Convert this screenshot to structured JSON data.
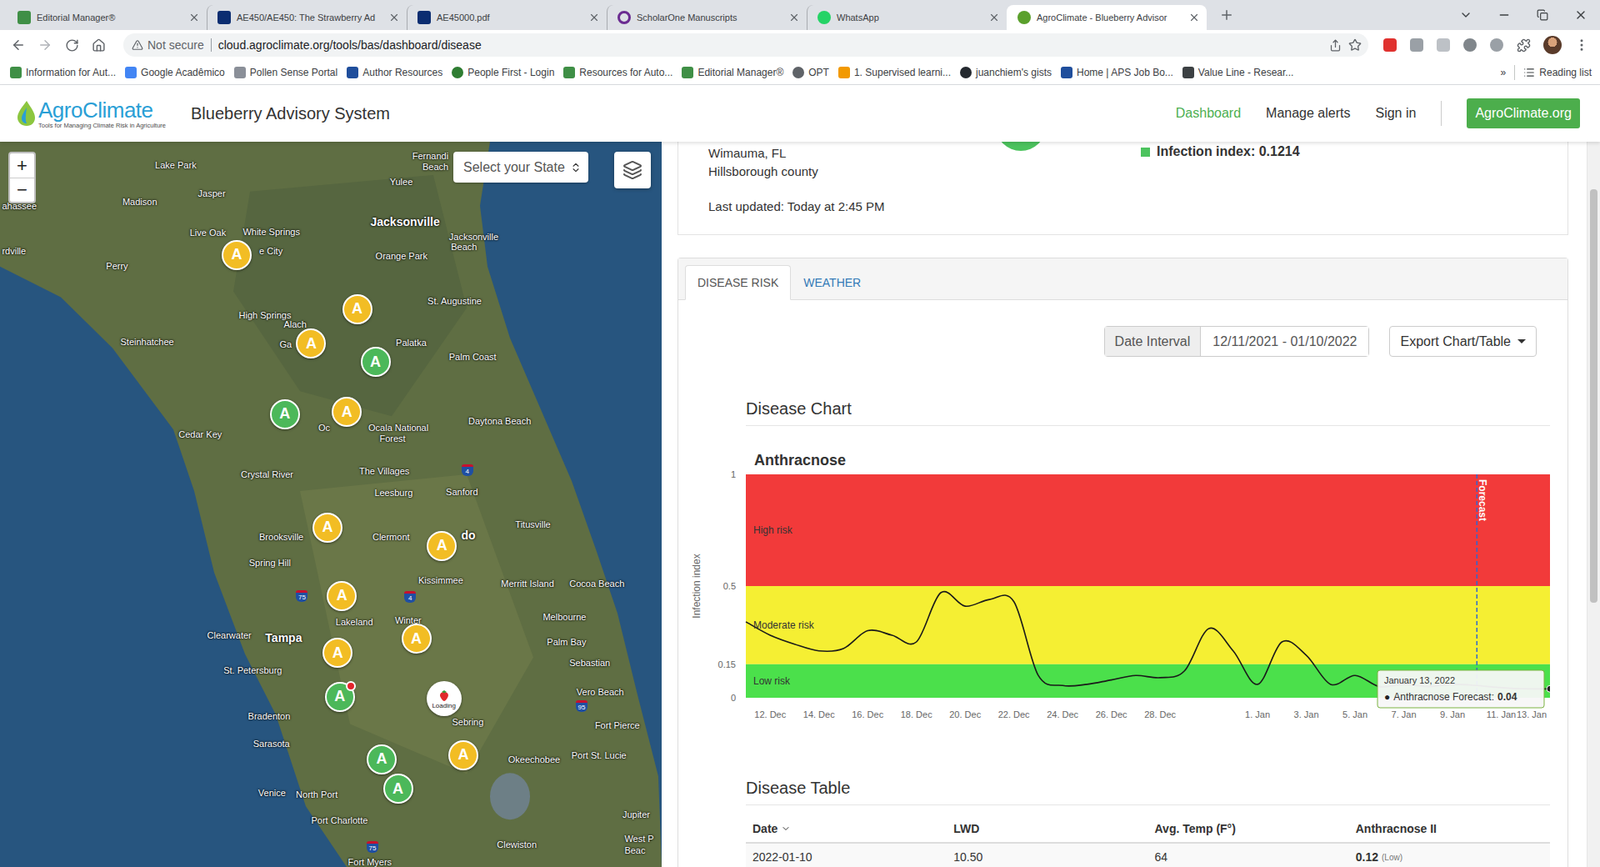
{
  "browser": {
    "tabs": [
      {
        "title": "Editorial Manager®",
        "selected": false,
        "kind": "em"
      },
      {
        "title": "AE450/AE450: The Strawberry Ad",
        "selected": false,
        "kind": "ifas"
      },
      {
        "title": "AE45000.pdf",
        "selected": false,
        "kind": "ifas"
      },
      {
        "title": "ScholarOne Manuscripts",
        "selected": false,
        "kind": "scholarone"
      },
      {
        "title": "WhatsApp",
        "selected": false,
        "kind": "whatsapp"
      },
      {
        "title": "AgroClimate - Blueberry Advisor",
        "selected": true,
        "kind": "agro"
      }
    ],
    "security": "Not secure",
    "url": "cloud.agroclimate.org/tools/bas/dashboard/disease",
    "bookmarks": [
      {
        "label": "Information for Aut...",
        "kind": "em"
      },
      {
        "label": "Google Acadêmico",
        "kind": "scholar"
      },
      {
        "label": "Pollen Sense Portal",
        "kind": "page"
      },
      {
        "label": "Author Resources",
        "kind": "aps"
      },
      {
        "label": "People First - Login",
        "kind": "people"
      },
      {
        "label": "Resources for Auto...",
        "kind": "em"
      },
      {
        "label": "Editorial Manager®",
        "kind": "em"
      },
      {
        "label": "OPT",
        "kind": "opt"
      },
      {
        "label": "1. Supervised learni...",
        "kind": "chart"
      },
      {
        "label": "juanchiem's gists",
        "kind": "github"
      },
      {
        "label": "Home | APS Job Bo...",
        "kind": "aps"
      },
      {
        "label": "Value Line - Resear...",
        "kind": "valueline"
      }
    ],
    "more": "»",
    "reading_list": "Reading list"
  },
  "header": {
    "logo": {
      "name": "AgroClimate",
      "tagline": "Tools for Managing Climate Risk in Agriculture"
    },
    "title": "Blueberry Advisory System",
    "nav": [
      {
        "label": "Dashboard",
        "selected": true
      },
      {
        "label": "Manage alerts",
        "selected": false
      },
      {
        "label": "Sign in",
        "selected": false
      }
    ],
    "site_button": "AgroClimate.org"
  },
  "map": {
    "zoom_in": "+",
    "zoom_out": "−",
    "state_select": {
      "placeholder": "Select your State"
    },
    "labels": [
      {
        "text": "ahassee",
        "kind": "city"
      },
      {
        "text": "Lake Park",
        "kind": "city"
      },
      {
        "text": "Fernandi",
        "kind": "city"
      },
      {
        "text": "Beach",
        "kind": "city"
      },
      {
        "text": "Jasper",
        "kind": "city"
      },
      {
        "text": "Yulee",
        "kind": "city"
      },
      {
        "text": "Madison",
        "kind": "city"
      },
      {
        "text": "Jacksonville",
        "kind": "major"
      },
      {
        "text": "Jacksonville",
        "kind": "city"
      },
      {
        "text": "Beach",
        "kind": "city"
      },
      {
        "text": "Live Oak",
        "kind": "city"
      },
      {
        "text": "White Springs",
        "kind": "city"
      },
      {
        "text": "e City",
        "kind": "city"
      },
      {
        "text": "Orange Park",
        "kind": "city"
      },
      {
        "text": "rdville",
        "kind": "city"
      },
      {
        "text": "Perry",
        "kind": "city"
      },
      {
        "text": "High Springs",
        "kind": "city"
      },
      {
        "text": "Alach",
        "kind": "city"
      },
      {
        "text": "St. Augustine",
        "kind": "city"
      },
      {
        "text": "Palatka",
        "kind": "city"
      },
      {
        "text": "Palm Coast",
        "kind": "city"
      },
      {
        "text": "Steinhatchee",
        "kind": "city"
      },
      {
        "text": "Ga",
        "kind": "city"
      },
      {
        "text": "Oc",
        "kind": "city"
      },
      {
        "text": "Ocala National",
        "kind": "city"
      },
      {
        "text": "Forest",
        "kind": "city"
      },
      {
        "text": "Cedar Key",
        "kind": "city"
      },
      {
        "text": "Daytona Beach",
        "kind": "city"
      },
      {
        "text": "Crystal River",
        "kind": "city"
      },
      {
        "text": "The Villages",
        "kind": "city"
      },
      {
        "text": "Leesburg",
        "kind": "city"
      },
      {
        "text": "Sanford",
        "kind": "city"
      },
      {
        "text": "Brooksville",
        "kind": "city"
      },
      {
        "text": "Clermont",
        "kind": "city"
      },
      {
        "text": "do",
        "kind": "major"
      },
      {
        "text": "Titusville",
        "kind": "city"
      },
      {
        "text": "Spring Hill",
        "kind": "city"
      },
      {
        "text": "Kissimmee",
        "kind": "city"
      },
      {
        "text": "Merritt Island",
        "kind": "city"
      },
      {
        "text": "Cocoa Beach",
        "kind": "city"
      },
      {
        "text": "Lakeland",
        "kind": "city"
      },
      {
        "text": "Winter",
        "kind": "city"
      },
      {
        "text": "Melbourne",
        "kind": "city"
      },
      {
        "text": "Clearwater",
        "kind": "city"
      },
      {
        "text": "Tampa",
        "kind": "major"
      },
      {
        "text": "Palm Bay",
        "kind": "city"
      },
      {
        "text": "St. Petersburg",
        "kind": "city"
      },
      {
        "text": "Sebastian",
        "kind": "city"
      },
      {
        "text": "Sebring",
        "kind": "city"
      },
      {
        "text": "Bradenton",
        "kind": "city"
      },
      {
        "text": "Vero Beach",
        "kind": "city"
      },
      {
        "text": "Fort Pierce",
        "kind": "city"
      },
      {
        "text": "Sarasota",
        "kind": "city"
      },
      {
        "text": "Port St. Lucie",
        "kind": "city"
      },
      {
        "text": "Venice",
        "kind": "city"
      },
      {
        "text": "North Port",
        "kind": "city"
      },
      {
        "text": "Okeechobee",
        "kind": "city"
      },
      {
        "text": "Port Charlotte",
        "kind": "city"
      },
      {
        "text": "Jupiter",
        "kind": "city"
      },
      {
        "text": "Clewiston",
        "kind": "city"
      },
      {
        "text": "West P",
        "kind": "city"
      },
      {
        "text": "Beac",
        "kind": "city"
      },
      {
        "text": "Fort Myers",
        "kind": "city"
      }
    ],
    "shields": [
      "75",
      "4",
      "4",
      "95",
      "75"
    ],
    "stations": [
      {
        "label": "A",
        "color": "#f2bd24",
        "selected": false
      },
      {
        "label": "A",
        "color": "#f2bd24",
        "selected": false
      },
      {
        "label": "A",
        "color": "#f2bd24",
        "selected": false
      },
      {
        "label": "A",
        "color": "#4cb85a",
        "selected": false
      },
      {
        "label": "A",
        "color": "#4cb85a",
        "selected": false
      },
      {
        "label": "A",
        "color": "#f2bd24",
        "selected": false
      },
      {
        "label": "A",
        "color": "#f2bd24",
        "selected": false
      },
      {
        "label": "A",
        "color": "#f2bd24",
        "selected": false
      },
      {
        "label": "A",
        "color": "#f2bd24",
        "selected": false
      },
      {
        "label": "A",
        "color": "#f2bd24",
        "selected": false
      },
      {
        "label": "A",
        "color": "#f2bd24",
        "selected": false
      },
      {
        "label": "A",
        "color": "#4cb85a",
        "selected": true
      },
      {
        "label": "A",
        "color": "#4cb85a",
        "selected": false
      },
      {
        "label": "A",
        "color": "#f2bd24",
        "selected": false
      },
      {
        "label": "A",
        "color": "#4cb85a",
        "selected": false
      }
    ],
    "loading_station": {
      "label": "Loading"
    }
  },
  "station_card": {
    "location": "Wimauma, FL",
    "county": "Hillsborough county",
    "last_updated": "Last updated: Today at 2:45 PM",
    "risk_color": "#4cc35e",
    "infection_index": "Infection index: 0.1214"
  },
  "panel": {
    "tabs": [
      {
        "label": "DISEASE RISK",
        "selected": true
      },
      {
        "label": "WEATHER",
        "selected": false
      }
    ],
    "date_interval": {
      "label": "Date Interval",
      "value": "12/11/2021 - 01/10/2022"
    },
    "export": {
      "label": "Export Chart/Table"
    }
  },
  "chart": {
    "heading": "Disease Chart",
    "title": "Anthracnose",
    "y_axis": {
      "title": "Infection index",
      "ticks": [
        "1",
        "0.5",
        "0.15",
        "0"
      ]
    },
    "bands": [
      {
        "label": "High risk",
        "from": 0.5,
        "to": 1,
        "color": "#f23a3a"
      },
      {
        "label": "Moderate risk",
        "from": 0.15,
        "to": 0.5,
        "color": "#f5ef33"
      },
      {
        "label": "Low risk",
        "from": 0,
        "to": 0.15,
        "color": "#4be04b"
      }
    ],
    "x_axis": {
      "ticks": [
        {
          "label": "12. Dec",
          "day": 1
        },
        {
          "label": "14. Dec",
          "day": 3
        },
        {
          "label": "16. Dec",
          "day": 5
        },
        {
          "label": "18. Dec",
          "day": 7
        },
        {
          "label": "20. Dec",
          "day": 9
        },
        {
          "label": "22. Dec",
          "day": 11
        },
        {
          "label": "24. Dec",
          "day": 13
        },
        {
          "label": "26. Dec",
          "day": 15
        },
        {
          "label": "28. Dec",
          "day": 17
        },
        {
          "label": "1. Jan",
          "day": 21
        },
        {
          "label": "3. Jan",
          "day": 23
        },
        {
          "label": "5. Jan",
          "day": 25
        },
        {
          "label": "7. Jan",
          "day": 27
        },
        {
          "label": "9. Jan",
          "day": 29
        },
        {
          "label": "11. Jan",
          "day": 31
        },
        {
          "label": "13. Jan",
          "day": 33
        }
      ]
    },
    "series": [
      {
        "name": "Anthracnose",
        "values": [
          0.34,
          0.28,
          0.24,
          0.21,
          0.22,
          0.3,
          0.28,
          0.25,
          0.47,
          0.41,
          0.44,
          0.43,
          0.1,
          0.055,
          0.06,
          0.08,
          0.1,
          0.09,
          0.12,
          0.31,
          0.21,
          0.06,
          0.25,
          0.19,
          0.06,
          0.1,
          0.05,
          0.06,
          0.05,
          0.06,
          0.055,
          0.045,
          0.04,
          0.04
        ]
      }
    ],
    "forecast": {
      "label": "Forecast",
      "start_day": 30
    },
    "tooltip": {
      "date": "January 13, 2022",
      "bullet": "●",
      "label": "Anthracnose Forecast:",
      "value": "0.04",
      "day": 33
    }
  },
  "table": {
    "heading": "Disease Table",
    "columns": [
      {
        "label": "Date",
        "sorted": true
      },
      {
        "label": "LWD",
        "sorted": false
      },
      {
        "label": "Avg. Temp (F°)",
        "sorted": false
      },
      {
        "label": "Anthracnose II",
        "sorted": false
      }
    ],
    "rows": [
      {
        "cells": [
          "2022-01-10",
          "10.50",
          "64",
          "0.12"
        ],
        "risk": "(Low)"
      }
    ]
  },
  "page_scroll": {
    "thumb_start": 0.066,
    "thumb_size": 0.57
  }
}
